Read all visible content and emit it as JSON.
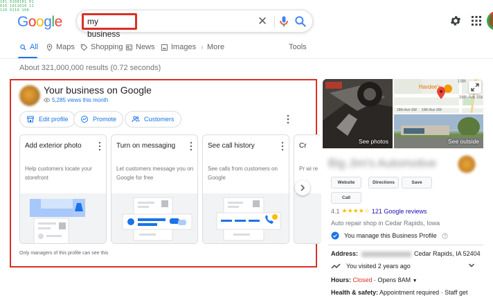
{
  "header": {
    "logo": {
      "letters": [
        "G",
        "o",
        "o",
        "g",
        "l",
        "e"
      ]
    },
    "search": {
      "value": "my business"
    },
    "icons": {
      "clear": "close-icon",
      "mic": "mic-icon",
      "search": "search-icon",
      "settings": "gear-icon",
      "apps": "apps-grid-icon"
    }
  },
  "tabs": {
    "items": [
      {
        "label": "All",
        "icon": "search-icon"
      },
      {
        "label": "Maps",
        "icon": "map-pin-icon"
      },
      {
        "label": "Shopping",
        "icon": "tag-icon"
      },
      {
        "label": "News",
        "icon": "news-icon"
      },
      {
        "label": "Images",
        "icon": "image-icon"
      },
      {
        "label": "More",
        "icon": "more-vert-icon"
      }
    ],
    "tools": "Tools",
    "active": "All"
  },
  "results": {
    "stats": "About 321,000,000 results (0.72 seconds)"
  },
  "merchant": {
    "title": "Your business on Google",
    "views": "5,285 views this month",
    "actions": [
      {
        "label": "Edit profile",
        "icon": "storefront-icon"
      },
      {
        "label": "Promote",
        "icon": "promote-icon"
      },
      {
        "label": "Customers",
        "icon": "people-icon"
      }
    ],
    "cards": [
      {
        "title": "Add exterior photo",
        "desc": "Help customers locate your storefront"
      },
      {
        "title": "Turn on messaging",
        "desc": "Let customers message you on Google for free"
      },
      {
        "title": "See call history",
        "desc": "See calls from customers on Google"
      },
      {
        "title": "Cr",
        "desc": "Pr wi re"
      }
    ],
    "footnote": "Only managers of this profile can see this"
  },
  "knowledge_panel": {
    "photos": {
      "see_photos": "See photos",
      "see_outside": "See outside"
    },
    "map": {
      "place": "Hardee's",
      "street_15th": "15th",
      "street_16th": "16th Ave SW",
      "street_18th": "18th Ave SW",
      "street_19th": "19th Ave SW"
    },
    "name": "Big Jim's Automotive",
    "buttons": [
      "Website",
      "Directions",
      "Save",
      "Call"
    ],
    "rating": {
      "value": "4.1",
      "stars": "★★★★☆",
      "reviews": "121 Google reviews"
    },
    "category": "Auto repair shop in Cedar Rapids, Iowa",
    "manage": "You manage this Business Profile",
    "address_label": "Address:",
    "address_value": "Cedar Rapids, IA 52404",
    "visited": "You visited 2 years ago",
    "hours_label": "Hours:",
    "hours_status": "Closed",
    "hours_value": "· Opens 8AM",
    "safety_label": "Health & safety:",
    "safety_value": "Appointment required · Staff get"
  },
  "colors": {
    "accent": "#1a73e8",
    "highlight_border": "#d93025",
    "star": "#fbbc05",
    "closed": "#d93025",
    "review_link": "#1a0dab"
  }
}
